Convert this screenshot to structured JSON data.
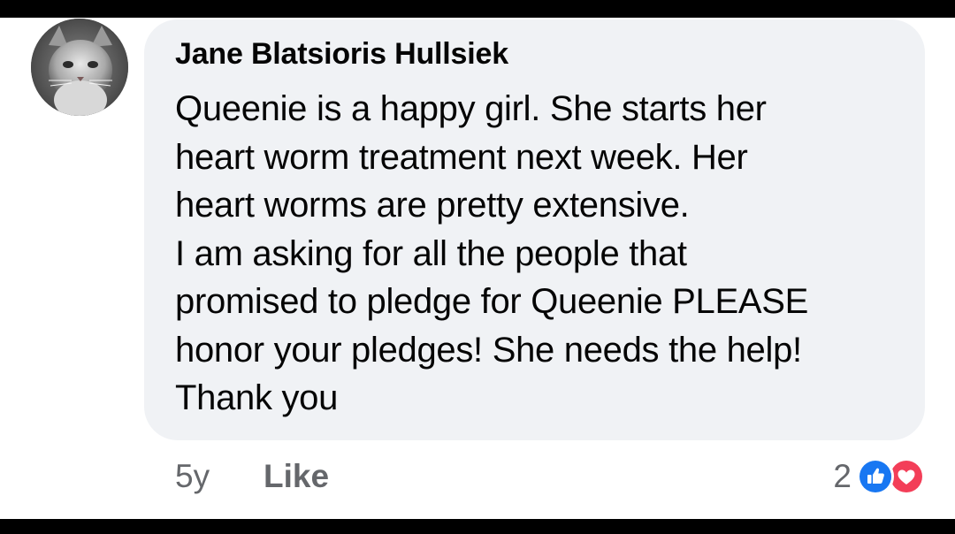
{
  "comment": {
    "author": "Jane Blatsioris Hullsiek",
    "lines": [
      "Queenie is a happy girl. She starts her",
      "heart worm treatment next week. Her",
      "heart worms are pretty extensive.",
      "I am asking for all the people that",
      "promised to pledge for Queenie PLEASE",
      "honor your pledges! She needs the help!",
      "Thank you"
    ]
  },
  "actions": {
    "timestamp": "5y",
    "like_label": "Like"
  },
  "reactions": {
    "count": "2",
    "icons": [
      "thumbs-up-icon",
      "heart-icon"
    ]
  },
  "colors": {
    "bubble": "#f0f2f5",
    "text": "#050505",
    "secondary": "#65676b",
    "like_blue": "#1877f2",
    "love_red": "#f33e58"
  }
}
